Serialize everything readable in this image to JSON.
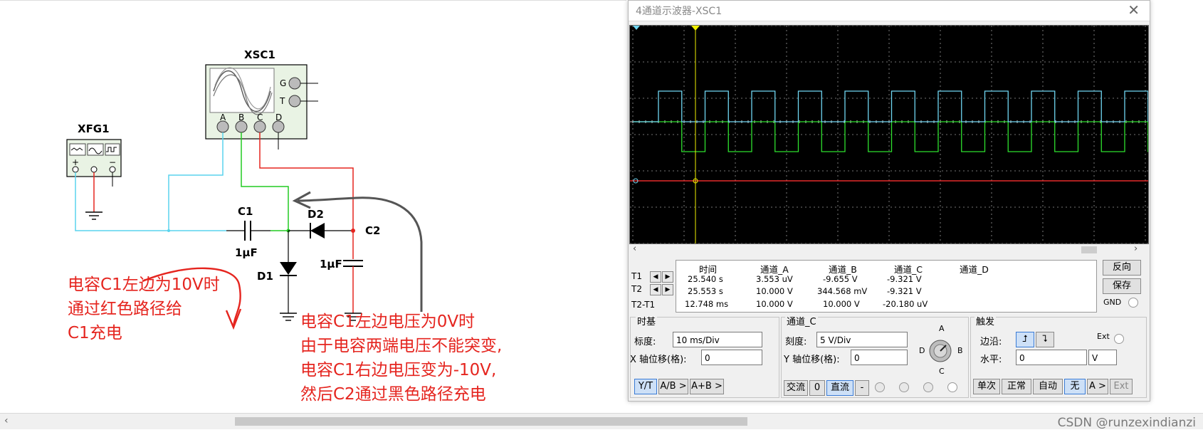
{
  "schematic": {
    "xfg_label": "XFG1",
    "xsc_label": "XSC1",
    "c1_label": "C1",
    "c1_value": "1µF",
    "c2_label": "C2",
    "c2_value": "1µF",
    "d1_label": "D1",
    "d2_label": "D2",
    "scope_terminal_g": "G",
    "scope_terminal_t": "T",
    "scope_channels": [
      "A",
      "B",
      "C",
      "D"
    ],
    "fg_plus": "+",
    "fg_minus": "−",
    "wire_colors": {
      "red": "#e5251f",
      "green": "#22cc22",
      "cyan": "#5ad4ee",
      "black": "#000000"
    }
  },
  "annotations": {
    "note1_line1": "电容C1左边为10V时",
    "note1_line2": "通过红色路径给",
    "note1_line3": "C1充电",
    "note2_line1": "电容C1左边电压为0V时",
    "note2_line2": "由于电容两端电压不能突变,",
    "note2_line3": "电容C1右边电压变为-10V,",
    "note2_line4": "然后C2通过黑色路径充电"
  },
  "watermark": "CSDN @runzexindianzi",
  "scope": {
    "title": "4通道示波器-XSC1",
    "close": "✕",
    "readout": {
      "headers": [
        "时间",
        "通道_A",
        "通道_B",
        "通道_C",
        "通道_D"
      ],
      "rows": [
        {
          "label": "T1",
          "time": "25.540 s",
          "a": "3.553 uV",
          "b": "-9.655 V",
          "c": "-9.321 V",
          "d": ""
        },
        {
          "label": "T2",
          "time": "25.553 s",
          "a": "10.000 V",
          "b": "344.568 mV",
          "c": "-9.321 V",
          "d": ""
        },
        {
          "label": "T2-T1",
          "time": "12.748 ms",
          "a": "10.000 V",
          "b": "10.000 V",
          "c": "-20.180 uV",
          "d": ""
        }
      ]
    },
    "buttons": {
      "reverse": "反向",
      "save": "保存",
      "gnd": "GND"
    },
    "timebase": {
      "title": "时基",
      "scale_label": "标度:",
      "scale_value": "10 ms/Div",
      "xpos_label": "X 轴位移(格):",
      "xpos_value": "0",
      "mode_yt": "Y/T",
      "mode_ab": "A/B >",
      "mode_apb": "A+B >"
    },
    "channel": {
      "title": "通道_C",
      "scale_label": "刻度:",
      "scale_value": "5  V/Div",
      "ypos_label": "Y 轴位移(格):",
      "ypos_value": "0",
      "ac": "交流",
      "zero": "0",
      "dc": "直流",
      "minus": "-",
      "knob_labels": [
        "A",
        "B",
        "C",
        "D"
      ]
    },
    "trigger": {
      "title": "触发",
      "edge_label": "边沿:",
      "ext_label": "Ext",
      "level_label": "水平:",
      "level_value": "0",
      "level_unit": "V",
      "single": "单次",
      "normal": "正常",
      "auto": "自动",
      "none": "无",
      "a_btn": "A >",
      "ext_btn": "Ext"
    },
    "colors": {
      "channel_a": "#2ee02e",
      "channel_b": "#6fd6f2",
      "channel_c": "#e52b2b",
      "cursor": "#f2f200",
      "grid": "#9a9a9a"
    }
  }
}
